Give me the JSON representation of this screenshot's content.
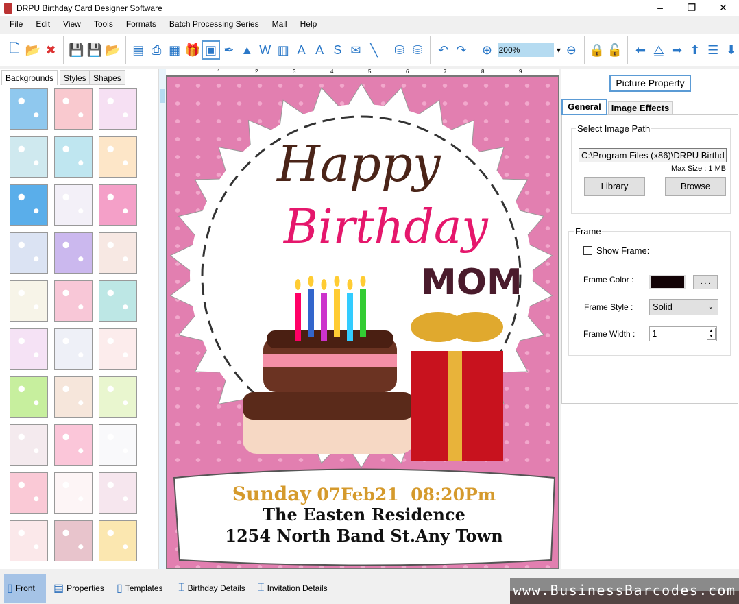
{
  "window": {
    "title": "DRPU Birthday Card Designer Software",
    "minimize": "–",
    "maximize": "❐",
    "close": "✕"
  },
  "menu": [
    "File",
    "Edit",
    "View",
    "Tools",
    "Formats",
    "Batch Processing Series",
    "Mail",
    "Help"
  ],
  "toolbar": {
    "zoom_value": "200%",
    "icons": [
      "new-icon",
      "open-icon",
      "close-icon",
      "save-icon",
      "save-as-icon",
      "export-icon",
      "properties-icon",
      "print-icon",
      "print-preview-icon",
      "gift-icon",
      "insert-image-icon",
      "pen-icon",
      "shapes-icon",
      "wordart-icon",
      "barcode-icon",
      "text-icon",
      "text-box-icon",
      "signature-icon",
      "mail-icon",
      "line-icon",
      "database-icon",
      "database2-icon",
      "undo-icon",
      "redo-icon",
      "zoom-in-icon",
      "zoom-out-icon",
      "lock-icon",
      "unlock-icon",
      "arrow-left-icon",
      "flip-icon",
      "arrow-right-icon",
      "arrow-up-icon",
      "align-icon",
      "arrow-down-icon"
    ]
  },
  "left_tabs": [
    "Backgrounds",
    "Styles",
    "Shapes"
  ],
  "thumb_colors": [
    "#8fc8ee",
    "#f9c9cf",
    "#f6e0f3",
    "#cfe9ef",
    "#bfe6f0",
    "#fde6c8",
    "#5aaeea",
    "#f3f0f8",
    "#f4a0c8",
    "#dbe3f3",
    "#cbb8ee",
    "#f7e8e3",
    "#f7f4e8",
    "#f8c7d7",
    "#bde7e5",
    "#f5e2f5",
    "#eef0f7",
    "#fcecec",
    "#c7ef9e",
    "#f6e6db",
    "#e9f6cf",
    "#f4eaee",
    "#fbc6d9",
    "#f9f9fb",
    "#fac9d6",
    "#fdf5f6",
    "#f6e6ee",
    "#fbe8ea",
    "#e8c4cc",
    "#fbe7b0"
  ],
  "card": {
    "line1": "Happy",
    "line2": "Birthday",
    "line3": "MOM",
    "date_day": "Sunday",
    "date_rest": "07Feb21  08:20Pm",
    "address1": "The Easten Residence",
    "address2": "1254 North Band St.Any Town"
  },
  "ruler": [
    "1",
    "2",
    "3",
    "4",
    "5",
    "6",
    "7",
    "8",
    "9"
  ],
  "right": {
    "title": "Picture Property",
    "tabs": [
      "General",
      "Image Effects"
    ],
    "path_group": "Select Image Path",
    "path_value": "C:\\Program Files (x86)\\DRPU Birthd",
    "max_size": "Max Size : 1 MB",
    "library": "Library",
    "browse": "Browse",
    "frame_group": "Frame",
    "show_frame": "Show Frame:",
    "show_frame_checked": false,
    "frame_color_label": "Frame Color :",
    "frame_color": "#120306",
    "more": ". . .",
    "frame_style_label": "Frame Style :",
    "frame_style": "Solid",
    "frame_width_label": "Frame Width :",
    "frame_width": "1"
  },
  "bottom_tabs": [
    "Front",
    "Properties",
    "Templates",
    "Birthday Details",
    "Invitation Details"
  ],
  "brand": "www.BusinessBarcodes.com"
}
